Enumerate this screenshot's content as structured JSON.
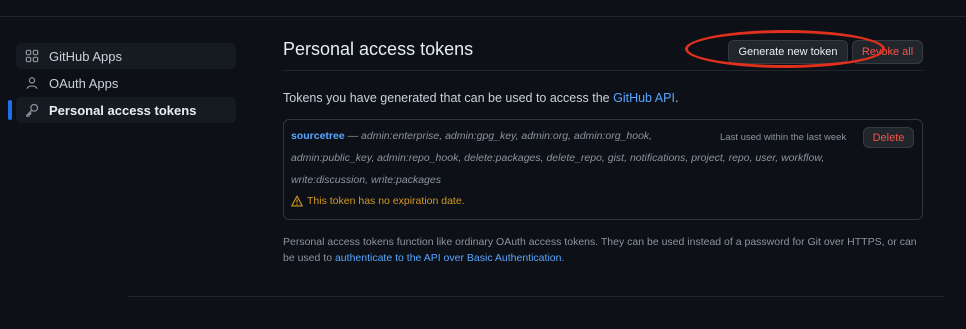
{
  "sidebar": {
    "items": [
      {
        "label": "GitHub Apps",
        "icon": "apps-grid-icon"
      },
      {
        "label": "OAuth Apps",
        "icon": "person-icon"
      },
      {
        "label": "Personal access tokens",
        "icon": "key-icon",
        "active": true
      }
    ]
  },
  "main": {
    "title": "Personal access tokens",
    "generate_button": "Generate new token",
    "revoke_all_button": "Revoke all",
    "intro_text": "Tokens you have generated that can be used to access the ",
    "intro_link": "GitHub API",
    "intro_end": ".",
    "token": {
      "name": "sourcetree",
      "separator": " — ",
      "scopes_line1": "admin:enterprise, admin:gpg_key, admin:org, admin:org_hook,",
      "scopes_line2": "admin:public_key, admin:repo_hook, delete:packages, delete_repo, gist, notifications, project, repo, user, workflow,",
      "scopes_line3": "write:discussion, write:packages",
      "last_used": "Last used within the last week",
      "delete_button": "Delete",
      "warning": "This token has no expiration date."
    },
    "footnote_text": "Personal access tokens function like ordinary OAuth access tokens. They can be used instead of a password for Git over HTTPS, or can be used to ",
    "footnote_link": "authenticate to the API over Basic Authentication",
    "footnote_end": "."
  },
  "colors": {
    "background": "#0d1117",
    "link": "#58a6ff",
    "danger": "#f85149",
    "warning": "#d29922",
    "annotation": "#e0301e"
  }
}
